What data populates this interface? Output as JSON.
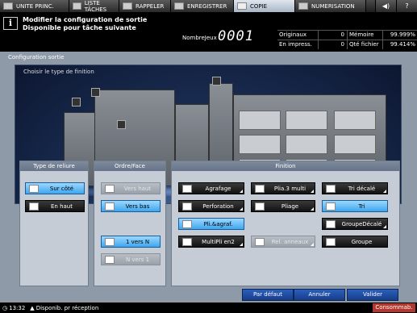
{
  "tabs": [
    {
      "label": "UNITE PRINC."
    },
    {
      "label": "LISTE TÂCHES"
    },
    {
      "label": "RAPPELER"
    },
    {
      "label": "ENREGISTRER"
    },
    {
      "label": "COPIE"
    },
    {
      "label": "NUMERISATION"
    }
  ],
  "header": {
    "message_line1": "Modifier la configuration de sortie",
    "message_line2": "Disponible pour tâche suivante",
    "nombre_jeux_label": "NombreJeux",
    "nombre_jeux_value": "0001"
  },
  "counters": {
    "originaux_label": "Originaux",
    "originaux_value": "0",
    "memoire_label": "Mémoire",
    "memoire_value": "99.999%",
    "en_impress_label": "En impress.",
    "en_impress_value": "0",
    "qte_fichier_label": "Qté fichier",
    "qte_fichier_value": "99.414%"
  },
  "panel": {
    "title": "Configuration sortie",
    "preview_title": "Choisir le type de finition"
  },
  "reliure": {
    "title": "Type de reliure",
    "buttons": [
      {
        "label": "Sur côté",
        "state": "selected"
      },
      {
        "label": "En haut",
        "state": "normal"
      }
    ]
  },
  "ordre": {
    "title": "Ordre/Face",
    "buttons": [
      {
        "label": "Vers haut",
        "state": "disabled"
      },
      {
        "label": "Vers bas",
        "state": "selected"
      },
      {
        "label": "1 vers N",
        "state": "selected"
      },
      {
        "label": "N vers 1",
        "state": "disabled"
      }
    ]
  },
  "finition": {
    "title": "Finition",
    "buttons": [
      {
        "label": "Agrafage",
        "state": "normal"
      },
      {
        "label": "Plia.3 multi",
        "state": "normal"
      },
      {
        "label": "Tri décalé",
        "state": "normal"
      },
      {
        "label": "Perforation",
        "state": "normal"
      },
      {
        "label": "Pliage",
        "state": "normal"
      },
      {
        "label": "Tri",
        "state": "selected"
      },
      {
        "label": "Pli.&agraf.",
        "state": "selected"
      },
      {
        "label": "GroupeDécalé",
        "state": "normal"
      },
      {
        "label": "MultiPli en2",
        "state": "normal"
      },
      {
        "label": "Rel. anneaux",
        "state": "disabled"
      },
      {
        "label": "Groupe",
        "state": "normal"
      }
    ]
  },
  "footer": {
    "par_defaut": "Par défaut",
    "annuler": "Annuler",
    "valider": "Valider"
  },
  "status": {
    "time": "13:32",
    "availability": "Disponib. pr réception",
    "consumables": "Consommab."
  },
  "colors": {
    "selected_button": "#3ea6ee",
    "panel_bg": "#8e9aa8",
    "footer_button": "#2a5fbf",
    "consumables_alert": "#b2372e"
  }
}
